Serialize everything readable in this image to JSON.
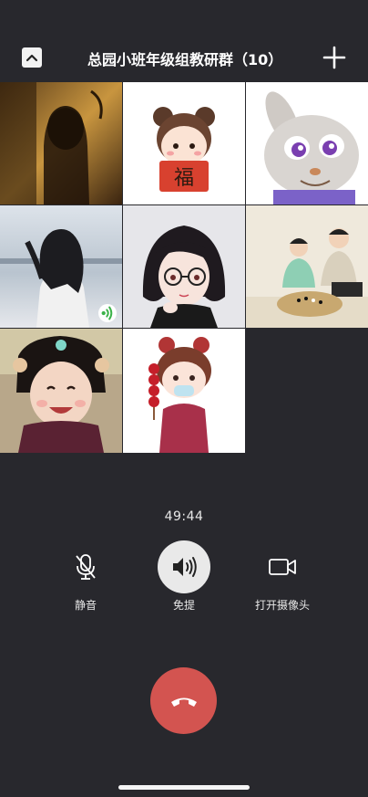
{
  "header": {
    "title": "总园小班年级组教研群（10）",
    "collapse_icon": "chevron-up-icon",
    "add_icon": "plus-icon"
  },
  "participants": [
    {
      "avatar": "silhouette-photo"
    },
    {
      "avatar": "cartoon-girl-fu"
    },
    {
      "avatar": "cartoon-rabbit"
    },
    {
      "avatar": "girl-back-photo",
      "speaking": true
    },
    {
      "avatar": "cartoon-girl-glasses"
    },
    {
      "avatar": "kids-playing-go"
    },
    {
      "avatar": "smiling-child-photo"
    },
    {
      "avatar": "cartoon-girl-tanghulu"
    }
  ],
  "call": {
    "timer": "49:44"
  },
  "controls": {
    "mute_label": "静音",
    "speaker_label": "免提",
    "camera_label": "打开摄像头"
  },
  "colors": {
    "background": "#28282d",
    "hangup": "#d35450",
    "speaker_active": "#e9e9e9",
    "speaking_green": "#3cb34a"
  }
}
